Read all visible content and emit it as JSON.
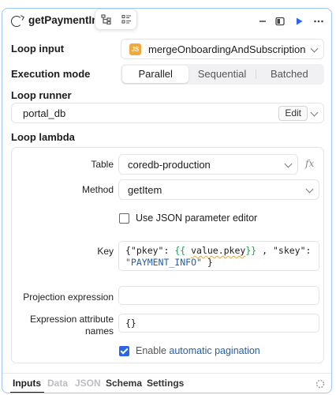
{
  "header": {
    "title": "getPaymentInfo"
  },
  "loop_input": {
    "label": "Loop input",
    "badge": "JS",
    "value": "mergeOnboardingAndSubscription"
  },
  "execution_mode": {
    "label": "Execution mode",
    "options": [
      "Parallel",
      "Sequential",
      "Batched"
    ],
    "selected": "Parallel"
  },
  "loop_runner": {
    "label": "Loop runner",
    "value": "portal_db",
    "edit_label": "Edit"
  },
  "loop_lambda": {
    "label": "Loop lambda",
    "table_label": "Table",
    "table_value": "coredb-production",
    "fx_label": "fx",
    "method_label": "Method",
    "method_value": "getItem",
    "json_editor_label": "Use JSON parameter editor",
    "json_editor_checked": false,
    "key_label": "Key",
    "key_line1": {
      "open": "{\"pkey\": ",
      "expr_open": "{{ ",
      "expr_value": "value.pkey",
      "expr_close": "}}",
      "mid": " , \"skey\":"
    },
    "key_line2": {
      "string": "\"PAYMENT_INFO\"",
      "close": " }"
    },
    "projection_label": "Projection expression",
    "projection_value": "",
    "expr_attr_label_1": "Expression attribute",
    "expr_attr_label_2": "names",
    "expr_attr_value": "{}",
    "pagination_prefix": "Enable ",
    "pagination_link": "automatic pagination",
    "pagination_checked": true
  },
  "tabs": [
    "Inputs",
    "Data",
    "JSON",
    "Schema",
    "Settings"
  ],
  "active_tab": "Inputs",
  "colors": {
    "accent": "#2c66e8",
    "panel_border": "#9ec3ff",
    "js_badge": "#f0a93a",
    "code_expr": "#16a34a",
    "code_string": "#1f5fae"
  }
}
